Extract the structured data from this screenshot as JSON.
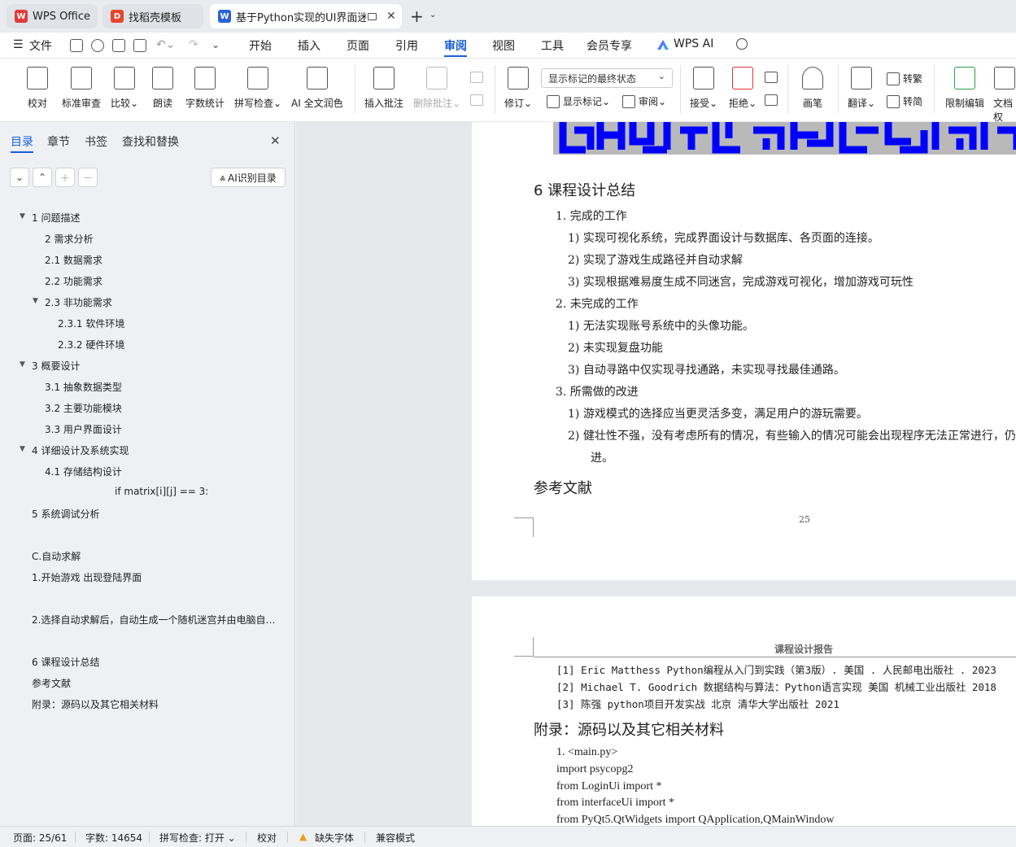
{
  "tabs": [
    {
      "label": "WPS Office",
      "icon": "wps-logo-icon",
      "color": "#e23b3b"
    },
    {
      "label": "找稻壳模板",
      "icon": "docer-icon",
      "color": "#e8442f"
    },
    {
      "label": "基于Python实现的UI界面迷宫",
      "icon": "word-doc-icon",
      "color": "#2a63d8"
    }
  ],
  "menu": {
    "file": "文件",
    "items": [
      "开始",
      "插入",
      "页面",
      "引用",
      "审阅",
      "视图",
      "工具",
      "会员专享"
    ],
    "active": "审阅",
    "wps_ai": "WPS AI"
  },
  "ribbon": {
    "buttons": [
      "校对",
      "标准审查",
      "比较",
      "朗读",
      "字数统计",
      "拼写检查",
      "AI 全文润色",
      "插入批注",
      "删除批注",
      "修订",
      "显示标记",
      "审阅",
      "接受",
      "拒绝",
      "画笔",
      "翻译",
      "转繁",
      "转简",
      "限制编辑",
      "文档权"
    ],
    "markup_select": "显示标记的最终状态"
  },
  "nav": {
    "tabs": [
      "目录",
      "章节",
      "书签",
      "查找和替换"
    ],
    "ai_button": "AI识别目录",
    "toc": [
      {
        "text": "1  问题描述",
        "level": 1,
        "expanded": true
      },
      {
        "text": "2  需求分析",
        "level": 2
      },
      {
        "text": "2.1  数据需求",
        "level": 2
      },
      {
        "text": "2.2  功能需求",
        "level": 2
      },
      {
        "text": "2.3  非功能需求",
        "level": 2,
        "expanded": true
      },
      {
        "text": "2.3.1 软件环境",
        "level": 3
      },
      {
        "text": "2.3.2 硬件环境",
        "level": 3
      },
      {
        "text": "3  概要设计",
        "level": 1,
        "expanded": true
      },
      {
        "text": "3.1 抽象数据类型",
        "level": 2
      },
      {
        "text": "3.2  主要功能模块",
        "level": 2
      },
      {
        "text": "3.3  用户界面设计",
        "level": 2
      },
      {
        "text": "4  详细设计及系统实现",
        "level": 1,
        "expanded": true
      },
      {
        "text": "4.1  存储结构设计",
        "level": 2
      },
      {
        "text": "if matrix[i][j] == 3:",
        "level": 4
      },
      {
        "text": "5  系统调试分析",
        "level": 1
      },
      {
        "text": "C.自动求解",
        "level": 1
      },
      {
        "text": "1.开始游戏  出现登陆界面",
        "level": 1
      },
      {
        "text": "2.选择自动求解后，自动生成一个随机迷宫并由电脑自 ...",
        "level": 1
      },
      {
        "text": "6  课程设计总结",
        "level": 1
      },
      {
        "text": "参考文献",
        "level": 1
      },
      {
        "text": "附录：源码以及其它相关材料",
        "level": 1
      }
    ]
  },
  "doc": {
    "section_title": "6  课程设计总结",
    "done_title": "1.    完成的工作",
    "done": [
      "1)    实现可视化系统，完成界面设计与数据库、各页面的连接。",
      "2)    实现了游戏生成路径并自动求解",
      "3)    实现根据难易度生成不同迷宫，完成游戏可视化，增加游戏可玩性"
    ],
    "undone_title": "2.    未完成的工作",
    "undone": [
      "1)    无法实现账号系统中的头像功能。",
      "2)    未实现复盘功能",
      "3)    自动寻路中仅实现寻找通路，未实现寻找最佳通路。"
    ],
    "improve_title": "3.    所需做的改进",
    "improve": [
      "1)    游戏模式的选择应当更灵活多变，满足用户的游玩需要。",
      "2)    健壮性不强，没有考虑所有的情况，有些输入的情况可能会出现程序无法正常进行，仍",
      "进。"
    ],
    "refs_title": "参考文献",
    "page_number": "25",
    "header": "课程设计报告",
    "refs": [
      "[1] Eric Matthess Python编程从入门到实践（第3版）. 美国 . 人民邮电出版社 . 2023",
      "[2] Michael T. Goodrich 数据结构与算法：Python语言实现 美国 机械工业出版社 2018",
      "[3] 陈强 python项目开发实战 北京 清华大学出版社 2021"
    ],
    "appendix_title": "附录：源码以及其它相关材料",
    "code": [
      "1.      <main.py>",
      "import psycopg2",
      "from LoginUi import *",
      "from interfaceUi import *",
      "from PyQt5.QtWidgets import QApplication,QMainWindow"
    ]
  },
  "status": {
    "page": "页面: 25/61",
    "words": "字数: 14654",
    "spell": "拼写检查: 打开",
    "proof": "校对",
    "missing_font": "缺失字体",
    "compat": "兼容模式"
  },
  "colors": {
    "accent": "#1a5fd6",
    "maze_wall": "#0000ff",
    "maze_exit": "#00cc00"
  }
}
